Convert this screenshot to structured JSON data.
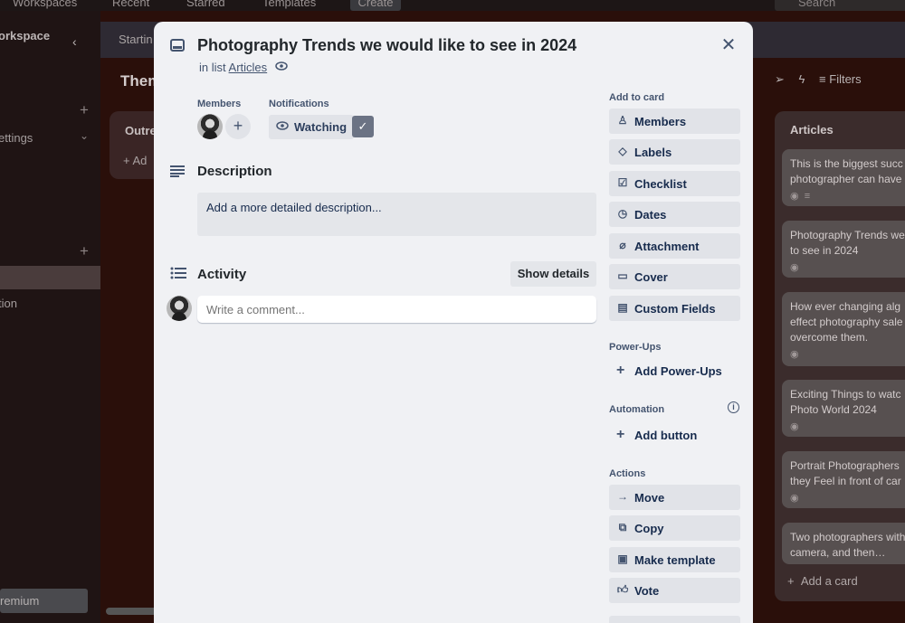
{
  "topnav": {
    "workspaces": "Workspaces",
    "recent": "Recent",
    "starred": "Starred",
    "templates": "Templates",
    "create": "Create",
    "search_placeholder": "Search"
  },
  "sidebar": {
    "workspace_label": "orkspace",
    "settings_label": "ettings",
    "item_label": "tion",
    "premium_label": "remium"
  },
  "board": {
    "header_tab": "Startin",
    "title": "Them",
    "filters": "Filters",
    "list_outre": {
      "title": "Outre",
      "add": "Ad"
    },
    "list_articles": {
      "title": "Articles",
      "cards": [
        "This is the biggest succ photographer can have",
        "Photography Trends we to see in 2024",
        "How ever changing alg effect photography sale overcome them.",
        "Exciting Things to watc Photo World 2024",
        "Portrait Photographers they Feel in front of car",
        "Two photographers with camera, and then…"
      ],
      "add_card": "Add a card"
    }
  },
  "modal": {
    "title": "Photography Trends we would like to see in 2024",
    "in_list_prefix": "in list",
    "list_name": "Articles",
    "members_label": "Members",
    "notifications_label": "Notifications",
    "watching_label": "Watching",
    "description_title": "Description",
    "description_placeholder": "Add a more detailed description...",
    "activity_title": "Activity",
    "show_details": "Show details",
    "comment_placeholder": "Write a comment..."
  },
  "sidebar_actions": {
    "add_to_card_label": "Add to card",
    "add_to_card": [
      "Members",
      "Labels",
      "Checklist",
      "Dates",
      "Attachment",
      "Cover",
      "Custom Fields"
    ],
    "powerups_label": "Power-Ups",
    "add_powerups": "Add Power-Ups",
    "automation_label": "Automation",
    "add_button": "Add button",
    "actions_label": "Actions",
    "actions": [
      "Move",
      "Copy",
      "Make template",
      "Vote"
    ]
  }
}
